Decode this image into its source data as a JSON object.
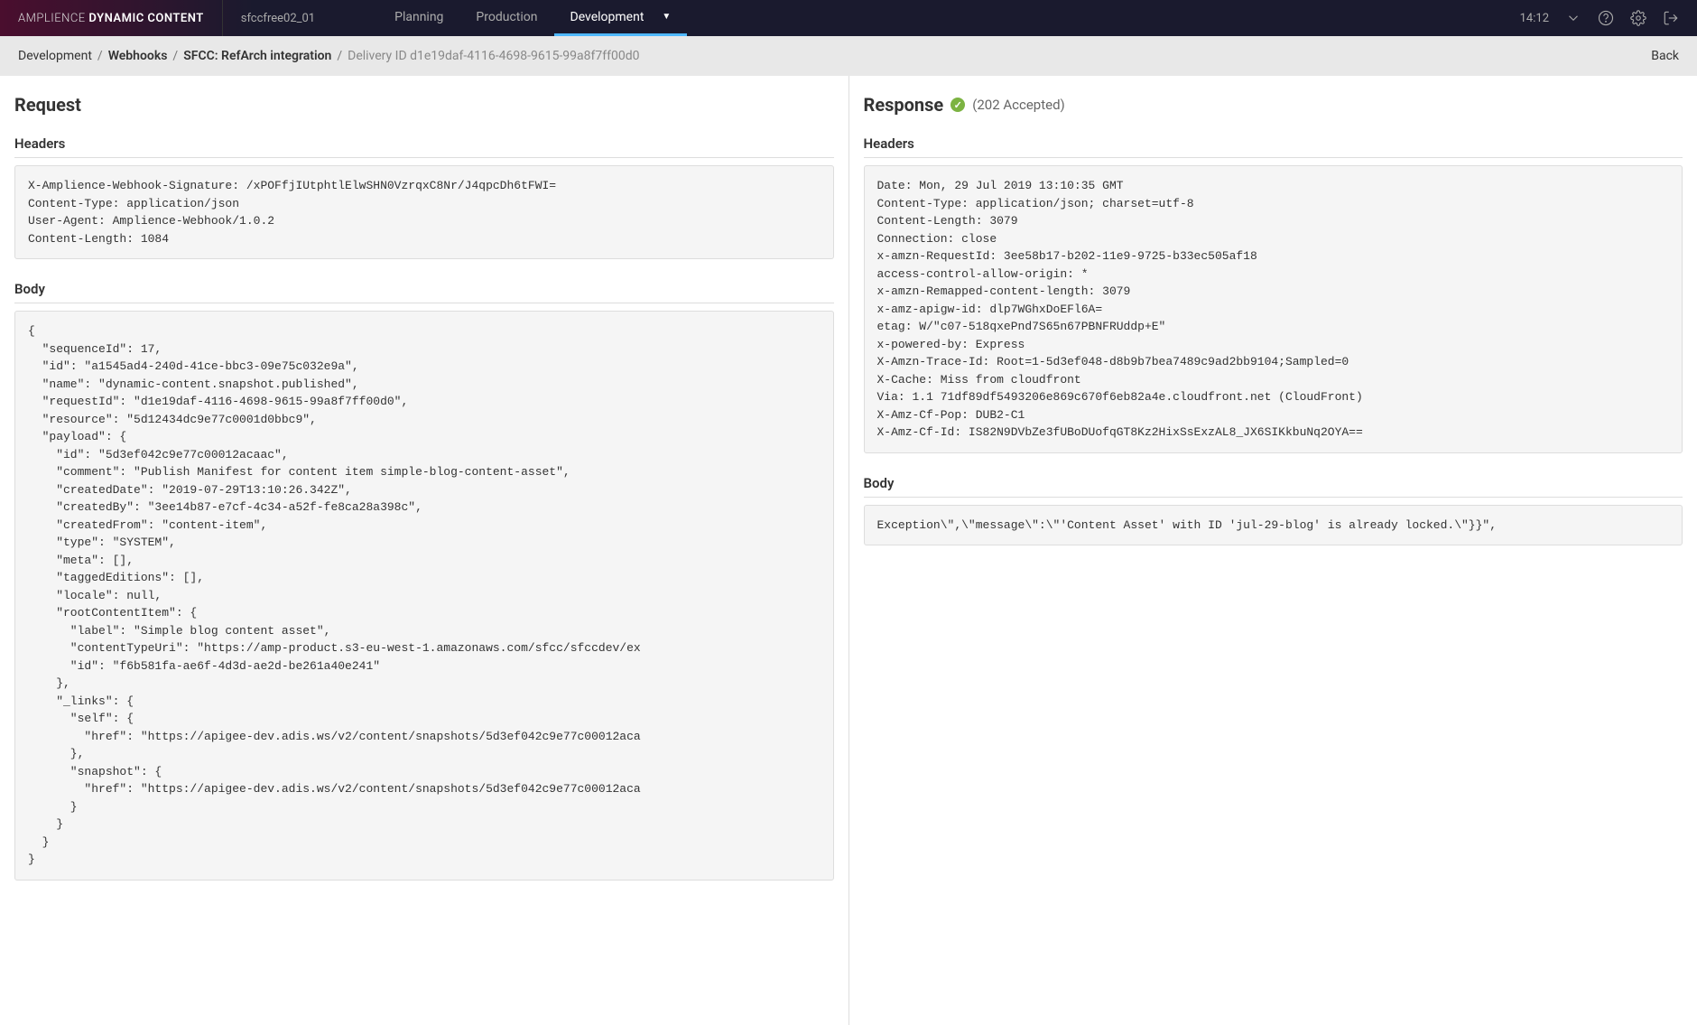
{
  "brand": {
    "light": "AMPLIENCE",
    "heavy": "DYNAMIC CONTENT"
  },
  "hub": "sfccfree02_01",
  "nav": {
    "tabs": [
      {
        "label": "Planning",
        "active": false
      },
      {
        "label": "Production",
        "active": false
      },
      {
        "label": "Development",
        "active": true
      }
    ],
    "time": "14:12"
  },
  "breadcrumbs": {
    "items": [
      {
        "label": "Development",
        "link": false
      },
      {
        "label": "Webhooks",
        "link": true
      },
      {
        "label": "SFCC: RefArch integration",
        "link": true
      },
      {
        "label": "Delivery ID d1e19daf-4116-4698-9615-99a8f7ff00d0",
        "link": false,
        "inactive": true
      }
    ],
    "back": "Back"
  },
  "request": {
    "title": "Request",
    "headers_heading": "Headers",
    "headers": "X-Amplience-Webhook-Signature: /xPOFfjIUtphtlElwSHN0VzrqxC8Nr/J4qpcDh6tFWI=\nContent-Type: application/json\nUser-Agent: Amplience-Webhook/1.0.2\nContent-Length: 1084",
    "body_heading": "Body",
    "body": "{\n  \"sequenceId\": 17,\n  \"id\": \"a1545ad4-240d-41ce-bbc3-09e75c032e9a\",\n  \"name\": \"dynamic-content.snapshot.published\",\n  \"requestId\": \"d1e19daf-4116-4698-9615-99a8f7ff00d0\",\n  \"resource\": \"5d12434dc9e77c0001d0bbc9\",\n  \"payload\": {\n    \"id\": \"5d3ef042c9e77c00012acaac\",\n    \"comment\": \"Publish Manifest for content item simple-blog-content-asset\",\n    \"createdDate\": \"2019-07-29T13:10:26.342Z\",\n    \"createdBy\": \"3ee14b87-e7cf-4c34-a52f-fe8ca28a398c\",\n    \"createdFrom\": \"content-item\",\n    \"type\": \"SYSTEM\",\n    \"meta\": [],\n    \"taggedEditions\": [],\n    \"locale\": null,\n    \"rootContentItem\": {\n      \"label\": \"Simple blog content asset\",\n      \"contentTypeUri\": \"https://amp-product.s3-eu-west-1.amazonaws.com/sfcc/sfccdev/ex\n      \"id\": \"f6b581fa-ae6f-4d3d-ae2d-be261a40e241\"\n    },\n    \"_links\": {\n      \"self\": {\n        \"href\": \"https://apigee-dev.adis.ws/v2/content/snapshots/5d3ef042c9e77c00012aca\n      },\n      \"snapshot\": {\n        \"href\": \"https://apigee-dev.adis.ws/v2/content/snapshots/5d3ef042c9e77c00012aca\n      }\n    }\n  }\n}"
  },
  "response": {
    "title": "Response",
    "status": "(202 Accepted)",
    "headers_heading": "Headers",
    "headers": "Date: Mon, 29 Jul 2019 13:10:35 GMT\nContent-Type: application/json; charset=utf-8\nContent-Length: 3079\nConnection: close\nx-amzn-RequestId: 3ee58b17-b202-11e9-9725-b33ec505af18\naccess-control-allow-origin: *\nx-amzn-Remapped-content-length: 3079\nx-amz-apigw-id: dlp7WGhxDoEFl6A=\netag: W/\"c07-518qxePnd7S65n67PBNFRUddp+E\"\nx-powered-by: Express\nX-Amzn-Trace-Id: Root=1-5d3ef048-d8b9b7bea7489c9ad2bb9104;Sampled=0\nX-Cache: Miss from cloudfront\nVia: 1.1 71df89df5493206e869c670f6eb82a4e.cloudfront.net (CloudFront)\nX-Amz-Cf-Pop: DUB2-C1\nX-Amz-Cf-Id: IS82N9DVbZe3fUBoDUofqGT8Kz2HixSsExzAL8_JX6SIKkbuNq2OYA==",
    "body_heading": "Body",
    "body": "Exception\\\",\\\"message\\\":\\\"'Content Asset' with ID 'jul-29-blog' is already locked.\\\"}}\","
  }
}
